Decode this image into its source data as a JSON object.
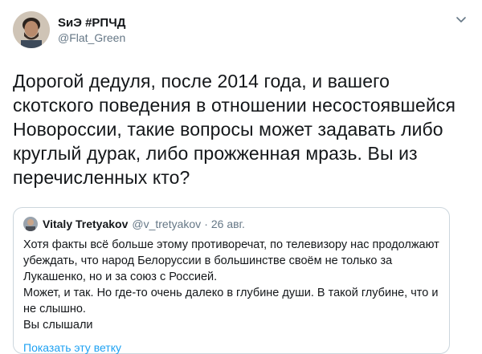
{
  "author": {
    "display_name": "SиЭ #РПЧД",
    "handle": "@Flat_Green",
    "avatar_icon": "user-avatar-photo"
  },
  "tweet": {
    "text": "Дорогой дедуля, после 2014 года, и вашего скотского поведения в отношении несостоявшейся Новороссии, такие вопросы может задавать либо круглый дурак, либо прожженная мразь. Вы из перечисленных кто?"
  },
  "quoted": {
    "display_name": "Vitaly Tretyakov",
    "handle": "@v_tretyakov",
    "separator": "·",
    "date": "26 авг.",
    "lines": [
      "Хотя факты всё больше этому противоречат, по телевизору нас продолжают убеждать, что народ Белоруссии в большинстве своём не только за Лукашенко, но и за союз с Россией.",
      "Может, и так. Но где-то очень далеко в глубине души. В такой глубине, что и не слышно.",
      "Вы слышали"
    ],
    "show_thread": "Показать эту ветку"
  },
  "colors": {
    "link": "#1da1f2",
    "secondary_text": "#657786",
    "border": "#ccd6dd"
  }
}
